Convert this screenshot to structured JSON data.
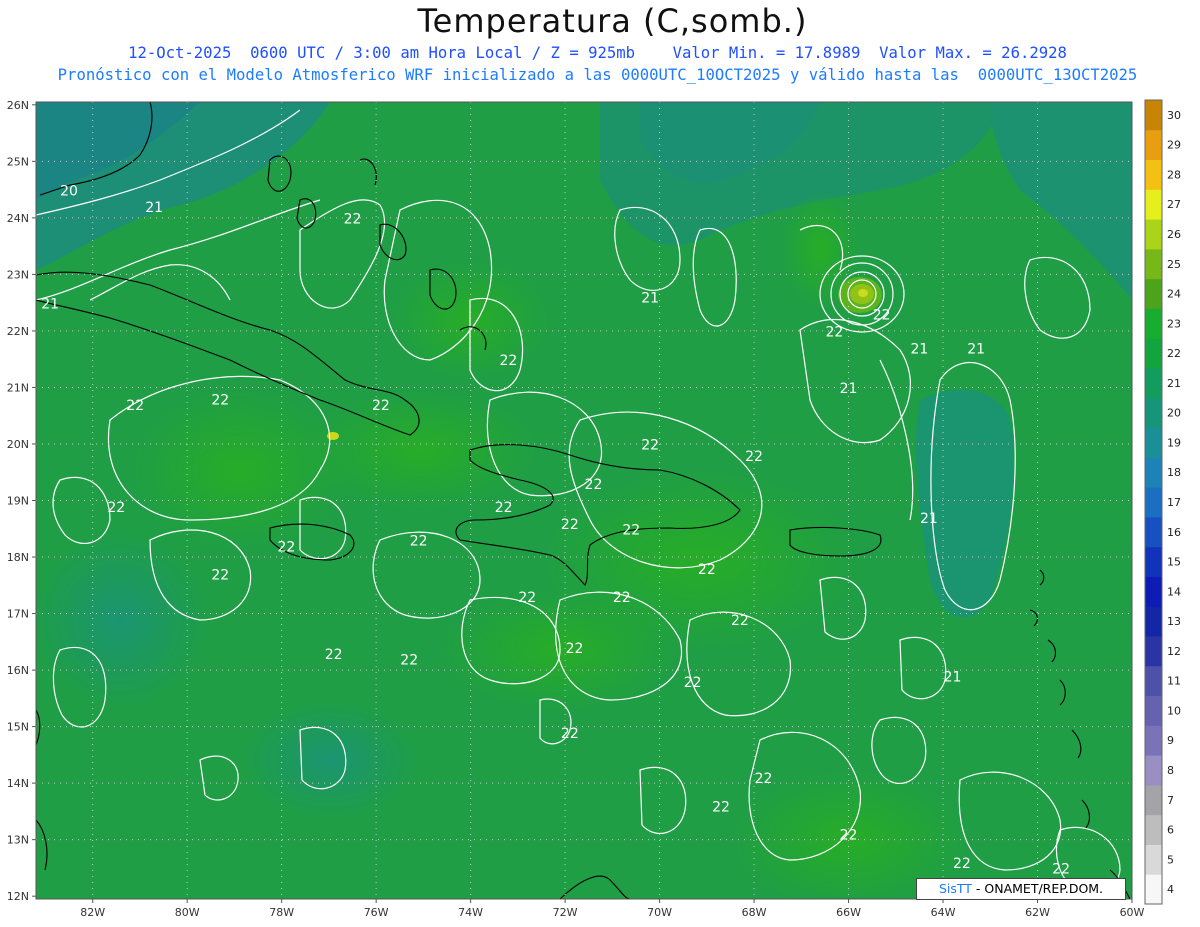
{
  "header": {
    "title": "Temperatura (C,somb.)",
    "line1": "12-Oct-2025  0600 UTC / 3:00 am Hora Local / Z = 925mb    Valor Min. = 17.8989  Valor Max. = 26.2928",
    "line2": "Pronóstico con el Modelo Atmosferico WRF inicializado a las 0000UTC_10OCT2025 y válido hasta las  0000UTC_13OCT2025"
  },
  "map": {
    "lat_labels": [
      "26N",
      "25N",
      "24N",
      "23N",
      "22N",
      "21N",
      "20N",
      "19N",
      "18N",
      "17N",
      "16N",
      "15N",
      "14N",
      "13N",
      "12N"
    ],
    "lon_labels": [
      "82W",
      "80W",
      "78W",
      "76W",
      "74W",
      "72W",
      "70W",
      "68W",
      "66W",
      "64W",
      "62W",
      "60W"
    ],
    "contour_labels": [
      {
        "text": "20",
        "lon": -82.5,
        "lat": 24.4
      },
      {
        "text": "21",
        "lon": -80.7,
        "lat": 24.1
      },
      {
        "text": "21",
        "lon": -82.9,
        "lat": 22.4
      },
      {
        "text": "22",
        "lon": -76.5,
        "lat": 23.9
      },
      {
        "text": "22",
        "lon": -73.2,
        "lat": 21.4
      },
      {
        "text": "22",
        "lon": -75.9,
        "lat": 20.6
      },
      {
        "text": "22",
        "lon": -81.1,
        "lat": 20.6
      },
      {
        "text": "22",
        "lon": -79.3,
        "lat": 20.7
      },
      {
        "text": "22",
        "lon": -81.5,
        "lat": 18.8
      },
      {
        "text": "22",
        "lon": -77.9,
        "lat": 18.1
      },
      {
        "text": "22",
        "lon": -79.3,
        "lat": 17.6
      },
      {
        "text": "22",
        "lon": -73.3,
        "lat": 18.8
      },
      {
        "text": "22",
        "lon": -71.9,
        "lat": 18.5
      },
      {
        "text": "22",
        "lon": -72.8,
        "lat": 17.2
      },
      {
        "text": "22",
        "lon": -70.8,
        "lat": 17.2
      },
      {
        "text": "22",
        "lon": -69.0,
        "lat": 17.7
      },
      {
        "text": "22",
        "lon": -68.3,
        "lat": 16.8
      },
      {
        "text": "22",
        "lon": -75.1,
        "lat": 18.2
      },
      {
        "text": "22",
        "lon": -76.9,
        "lat": 16.2
      },
      {
        "text": "22",
        "lon": -75.3,
        "lat": 16.1
      },
      {
        "text": "22",
        "lon": -71.8,
        "lat": 16.3
      },
      {
        "text": "22",
        "lon": -68.0,
        "lat": 19.7
      },
      {
        "text": "22",
        "lon": -70.2,
        "lat": 19.9
      },
      {
        "text": "22",
        "lon": -71.4,
        "lat": 19.2
      },
      {
        "text": "22",
        "lon": -70.6,
        "lat": 18.4
      },
      {
        "text": "22",
        "lon": -69.3,
        "lat": 15.7
      },
      {
        "text": "22",
        "lon": -71.9,
        "lat": 14.8
      },
      {
        "text": "22",
        "lon": -67.8,
        "lat": 14.0
      },
      {
        "text": "22",
        "lon": -68.7,
        "lat": 13.5
      },
      {
        "text": "22",
        "lon": -66.0,
        "lat": 13.0
      },
      {
        "text": "22",
        "lon": -63.6,
        "lat": 12.5
      },
      {
        "text": "22",
        "lon": -61.5,
        "lat": 12.4
      },
      {
        "text": "22",
        "lon": -66.3,
        "lat": 21.9
      },
      {
        "text": "22",
        "lon": -65.3,
        "lat": 22.2
      },
      {
        "text": "21",
        "lon": -70.2,
        "lat": 22.5
      },
      {
        "text": "21",
        "lon": -64.5,
        "lat": 21.6
      },
      {
        "text": "21",
        "lon": -63.3,
        "lat": 21.6
      },
      {
        "text": "21",
        "lon": -66.0,
        "lat": 20.9
      },
      {
        "text": "21",
        "lon": -64.3,
        "lat": 18.6
      },
      {
        "text": "21",
        "lon": -63.8,
        "lat": 15.8
      }
    ]
  },
  "colorbar": {
    "labels": [
      "4",
      "5",
      "6",
      "7",
      "8",
      "9",
      "10",
      "11",
      "12",
      "13",
      "14",
      "15",
      "16",
      "17",
      "18",
      "19",
      "20",
      "21",
      "22",
      "23",
      "24",
      "25",
      "26",
      "27",
      "28",
      "29",
      "30"
    ],
    "colors": [
      "#f7f7f7",
      "#d9d9d9",
      "#bdbdbd",
      "#a3a3a8",
      "#9a8fc2",
      "#7b73b8",
      "#6563b0",
      "#4d51a8",
      "#2a35a5",
      "#1226a6",
      "#0d1cb5",
      "#1133bb",
      "#1750c0",
      "#1c6ec3",
      "#1d82b6",
      "#1a8f97",
      "#16957a",
      "#129c5e",
      "#11a43f",
      "#17ad2f",
      "#4ca41c",
      "#78b718",
      "#a9d41a",
      "#e6ef1c",
      "#f4c014",
      "#e79f10",
      "#c88405"
    ]
  },
  "credit": {
    "logo": "SisTT",
    "text": " - ONAMET/REP.DOM."
  }
}
